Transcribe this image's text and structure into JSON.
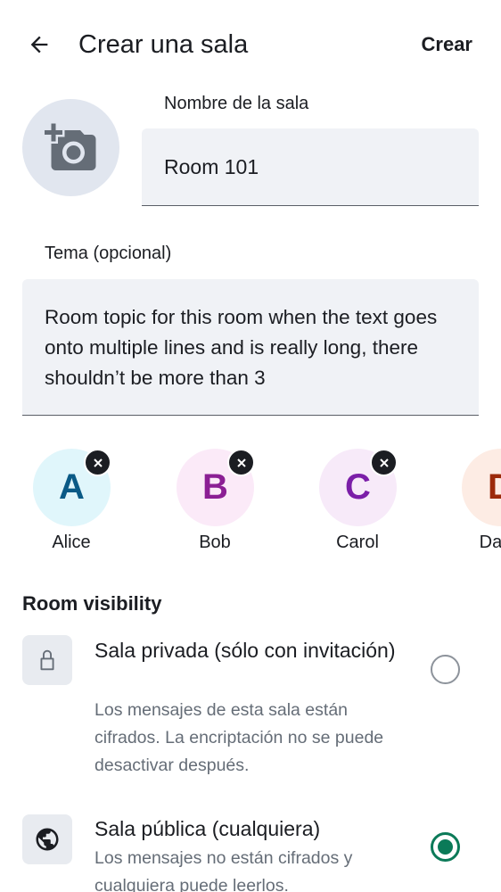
{
  "topbar": {
    "title": "Crear una sala",
    "create_label": "Crear"
  },
  "room_name": {
    "label": "Nombre de la sala",
    "value": "Room 101"
  },
  "topic": {
    "label": "Tema (opcional)",
    "value": "Room topic for this room when the text goes onto multiple lines and is really long, there shouldn’t be more than 3"
  },
  "members": [
    {
      "initial": "A",
      "name": "Alice",
      "bg": "#e0f6fb",
      "fg": "#0a5a86"
    },
    {
      "initial": "B",
      "name": "Bob",
      "bg": "#fbeaf8",
      "fg": "#8b1f94"
    },
    {
      "initial": "C",
      "name": "Carol",
      "bg": "#f7eaf9",
      "fg": "#7b1ea8"
    },
    {
      "initial": "D",
      "name": "Dave",
      "bg": "#fdece4",
      "fg": "#9c2a0a"
    }
  ],
  "visibility": {
    "title": "Room visibility",
    "options": [
      {
        "icon": "lock-icon",
        "title": "Sala privada (sólo con invitación)",
        "description": "Los mensajes de esta sala están cifrados. La encriptación no se puede desactivar después.",
        "selected": false
      },
      {
        "icon": "globe-icon",
        "title": "Sala pública (cualquiera)",
        "description": "Los mensajes no están cifrados y cualquiera puede leerlos.",
        "selected": true
      }
    ]
  },
  "colors": {
    "accent": "#0b7a58",
    "field_bg": "#f0f2f6",
    "text_primary": "#1b1d22",
    "text_secondary": "#656d77"
  }
}
